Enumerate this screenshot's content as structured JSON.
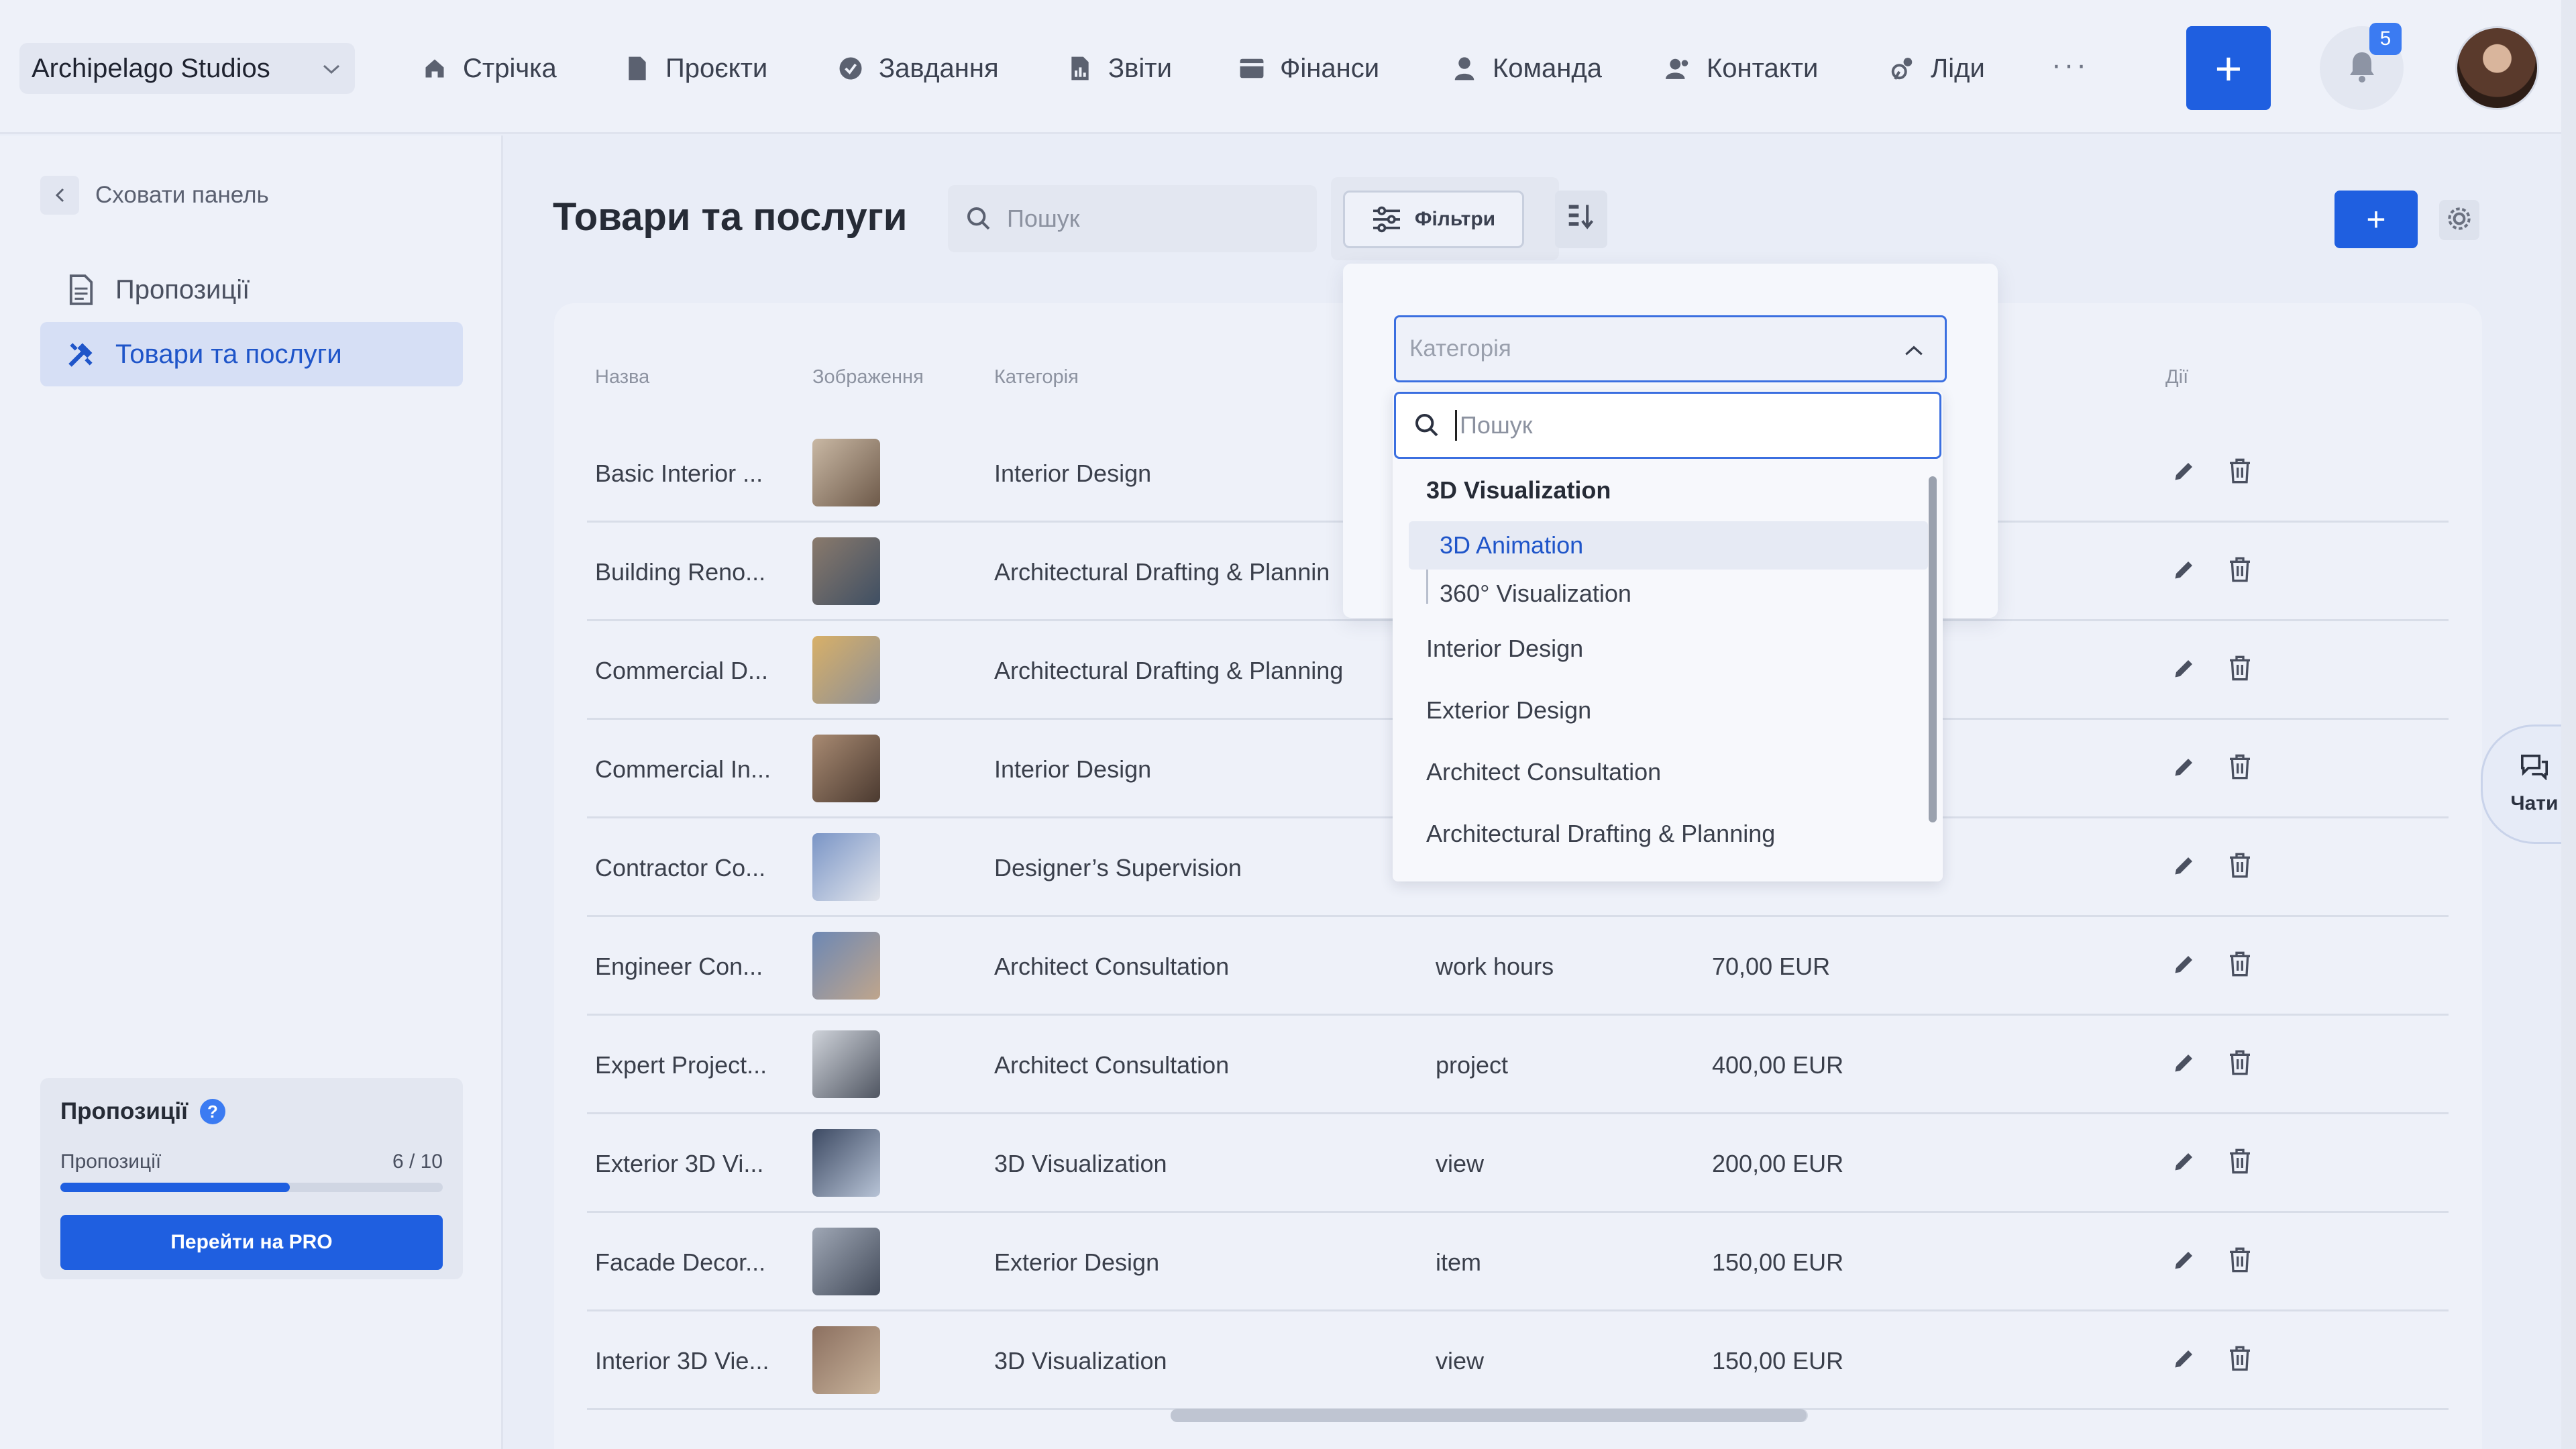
{
  "header": {
    "workspace": "Archipelago Studios",
    "nav": [
      {
        "label": "Стрічка",
        "icon": "home-icon"
      },
      {
        "label": "Проєкти",
        "icon": "document-icon"
      },
      {
        "label": "Завдання",
        "icon": "check-circle-icon"
      },
      {
        "label": "Звіти",
        "icon": "report-icon"
      },
      {
        "label": "Фінанси",
        "icon": "wallet-icon"
      },
      {
        "label": "Команда",
        "icon": "person-icon"
      },
      {
        "label": "Контакти",
        "icon": "contacts-icon"
      },
      {
        "label": "Ліди",
        "icon": "leads-icon"
      }
    ],
    "more": "···",
    "add_label": "+",
    "notifications_count": "5"
  },
  "sidebar": {
    "hide_label": "Сховати панель",
    "items": [
      {
        "label": "Пропозиції",
        "icon": "file-icon"
      },
      {
        "label": "Товари та послуги",
        "icon": "tools-icon"
      }
    ],
    "quota": {
      "title": "Пропозиції",
      "row_label": "Пропозиції",
      "count": "6 / 10",
      "progress": 0.6,
      "pro_button": "Перейти на PRO"
    }
  },
  "main": {
    "title": "Товари та послуги",
    "search_placeholder": "Пошук",
    "filters_label": "Фільтри",
    "add_label": "+",
    "columns": [
      "Назва",
      "Зображення",
      "Категорія",
      "Дії"
    ],
    "rows": [
      {
        "name": "Basic Interior ...",
        "category": "Interior Design",
        "unit": "",
        "price": ""
      },
      {
        "name": "Building Reno...",
        "category": "Architectural Drafting & Plannin",
        "unit": "",
        "price": ""
      },
      {
        "name": "Commercial D...",
        "category": "Architectural Drafting & Planning",
        "unit": "",
        "price": ""
      },
      {
        "name": "Commercial In...",
        "category": "Interior Design",
        "unit": "",
        "price": ""
      },
      {
        "name": "Contractor Co...",
        "category": "Designer’s Supervision",
        "unit": "",
        "price": ""
      },
      {
        "name": "Engineer Con...",
        "category": "Architect Consultation",
        "unit": "work hours",
        "price": "70,00 EUR"
      },
      {
        "name": "Expert Project...",
        "category": "Architect Consultation",
        "unit": "project",
        "price": "400,00 EUR"
      },
      {
        "name": "Exterior 3D Vi...",
        "category": "3D Visualization",
        "unit": "view",
        "price": "200,00 EUR"
      },
      {
        "name": "Facade Decor...",
        "category": "Exterior Design",
        "unit": "item",
        "price": "150,00 EUR"
      },
      {
        "name": "Interior 3D Vie...",
        "category": "3D Visualization",
        "unit": "view",
        "price": "150,00 EUR"
      }
    ]
  },
  "filter_dropdown": {
    "category_placeholder": "Категорія",
    "search_placeholder": "Пошук",
    "options": {
      "group": "3D Visualization",
      "sub1": "3D Animation",
      "sub2": "360° Visualization",
      "o1": "Interior Design",
      "o2": "Exterior Design",
      "o3": "Architect Consultation",
      "o4": "Architectural Drafting & Planning"
    }
  },
  "chat": {
    "label": "Чати"
  },
  "colors": {
    "accent": "#1f5fe0",
    "background": "#e9edf7",
    "selected_text": "#1f55c9"
  }
}
